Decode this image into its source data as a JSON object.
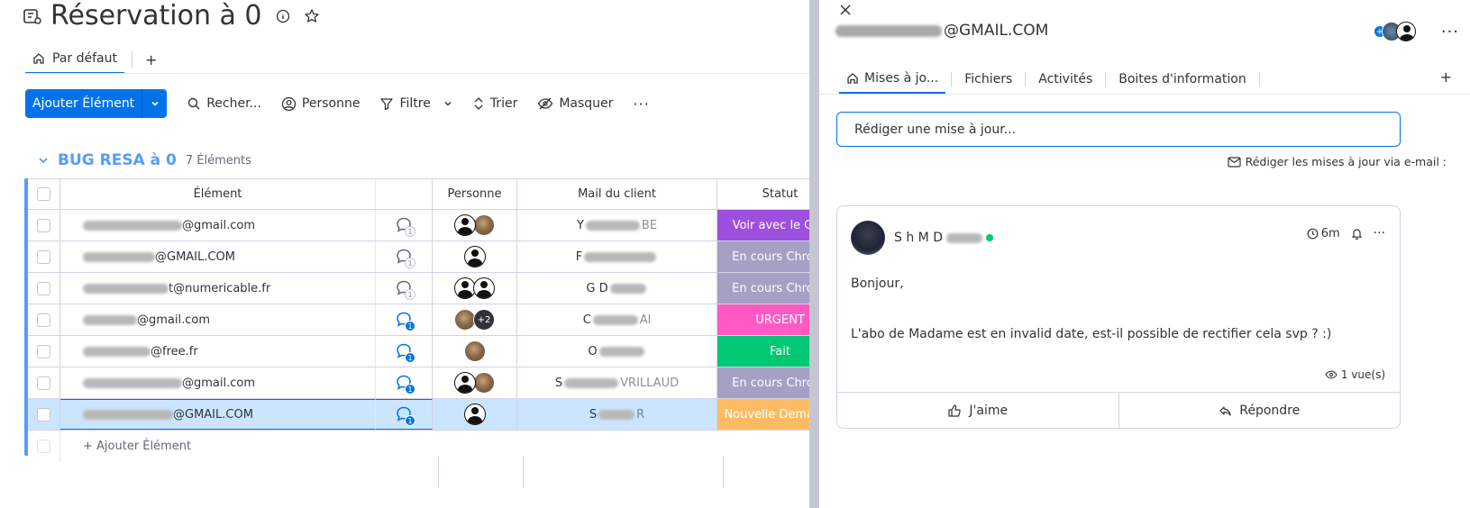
{
  "board": {
    "title": "Réservation à 0",
    "view_tab": "Par défaut",
    "view_add": "+",
    "toolbar": {
      "add_item": "Ajouter Élément",
      "search": "Recher...",
      "person": "Personne",
      "filter": "Filtre",
      "sort": "Trier",
      "hide": "Masquer",
      "more": "···"
    },
    "group": {
      "title": "BUG RESA à 0",
      "count": "7 Éléments",
      "color": "#579bfc"
    },
    "columns": [
      "Élément",
      "Personne",
      "Mail du client",
      "Statut"
    ],
    "rows": [
      {
        "item_suffix": "@gmail.com",
        "updates": "1",
        "has_unread": false,
        "people": [
          "generic",
          "photo"
        ],
        "more_people": "",
        "client_prefix": "Y",
        "client_suffix": "BE",
        "status": "Voir avec le Golf",
        "status_color": "#9d50dd"
      },
      {
        "item_suffix": "@GMAIL.COM",
        "updates": "1",
        "has_unread": false,
        "people": [
          "generic"
        ],
        "more_people": "",
        "client_prefix": "F",
        "client_suffix": "",
        "status": "En cours Chrono",
        "status_color": "#a4a1c4"
      },
      {
        "item_suffix": "t@numericable.fr",
        "updates": "1",
        "has_unread": false,
        "people": [
          "generic",
          "generic"
        ],
        "more_people": "",
        "client_prefix": "G D",
        "client_suffix": "",
        "status": "En cours Chrono",
        "status_color": "#a4a1c4"
      },
      {
        "item_suffix": "@gmail.com",
        "updates": "1",
        "has_unread": true,
        "people": [
          "photo"
        ],
        "more_people": "+2",
        "client_prefix": "C",
        "client_suffix": "Al",
        "status": "URGENT",
        "status_color": "#ff5ac4"
      },
      {
        "item_suffix": "@free.fr",
        "updates": "1",
        "has_unread": true,
        "people": [
          "photo"
        ],
        "more_people": "",
        "client_prefix": "O",
        "client_suffix": "",
        "status": "Fait",
        "status_color": "#00c875"
      },
      {
        "item_suffix": "@gmail.com",
        "updates": "1",
        "has_unread": true,
        "people": [
          "generic",
          "photo"
        ],
        "more_people": "",
        "client_prefix": "S",
        "client_suffix": "VRILLAUD",
        "status": "En cours Chrono",
        "status_color": "#a4a1c4"
      },
      {
        "item_suffix": "@GMAIL.COM",
        "updates": "1",
        "has_unread": true,
        "people": [
          "generic"
        ],
        "more_people": "",
        "client_prefix": "S",
        "client_suffix": "R",
        "status": "Nouvelle Demande",
        "status_color": "#fdbc64"
      }
    ],
    "add_row": "+ Ajouter Élément"
  },
  "panel": {
    "title_suffix": "@GMAIL.COM",
    "tabs": [
      "Mises à jo...",
      "Fichiers",
      "Activités",
      "Boites d'information"
    ],
    "tab_add": "+",
    "more": "···",
    "composer_placeholder": "Rédiger une mise à jour...",
    "email_hint": "Rédiger les mises à jour via e-mail :",
    "post": {
      "author_visible": "S  h M    D",
      "time": "6m",
      "greeting": "Bonjour,",
      "message": "L'abo de Madame est en invalid date, est-il possible de rectifier cela svp ? :)",
      "views": "1 vue(s)",
      "like": "J'aime",
      "reply": "Répondre"
    }
  }
}
